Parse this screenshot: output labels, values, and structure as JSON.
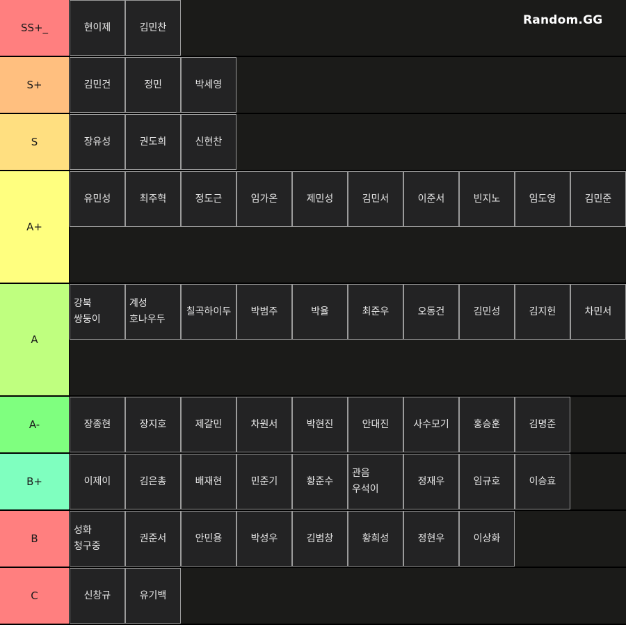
{
  "watermark": "Random.GG",
  "tiers": [
    {
      "label": "SS+_",
      "color": "#ff7f7f",
      "items": [
        "현이제",
        "김민찬"
      ]
    },
    {
      "label": "S+",
      "color": "#ffbf7f",
      "items": [
        "김민건",
        "정민",
        "박세영"
      ]
    },
    {
      "label": "S",
      "color": "#ffdf80",
      "items": [
        "장유성",
        "권도희",
        "신현찬"
      ]
    },
    {
      "label": "A+",
      "color": "#ffff7f",
      "items": [
        "유민성",
        "최주혁",
        "정도근",
        "임가온",
        "제민성",
        "김민서",
        "이준서",
        "빈지노",
        "임도영",
        "김민준"
      ]
    },
    {
      "label": "A",
      "color": "#bfff7f",
      "items": [
        "강북 쌍둥이",
        "계성 호나우두",
        "칠곡하이두",
        "박범주",
        "박율",
        "최준우",
        "오동건",
        "김민성",
        "김지헌",
        "차민서"
      ]
    },
    {
      "label": "A-",
      "color": "#7fff7f",
      "items": [
        "장종현",
        "장지호",
        "제갈민",
        "차원서",
        "박현진",
        "안대진",
        "사수모기",
        "홍승훈",
        "김명준"
      ]
    },
    {
      "label": "B+",
      "color": "#7fffbf",
      "items": [
        "이제이",
        "김은총",
        "배재현",
        "민준기",
        "황준수",
        "관음 우석이",
        "정재우",
        "임규호",
        "이승효"
      ]
    },
    {
      "label": "B",
      "color": "#ff7f7f",
      "items": [
        "성화 청구중",
        "권준서",
        "안민용",
        "박성우",
        "김범창",
        "황희성",
        "정현우",
        "이상화"
      ]
    },
    {
      "label": "C",
      "color": "#ff7f7f",
      "items": [
        "신창규",
        "유기백"
      ]
    }
  ]
}
